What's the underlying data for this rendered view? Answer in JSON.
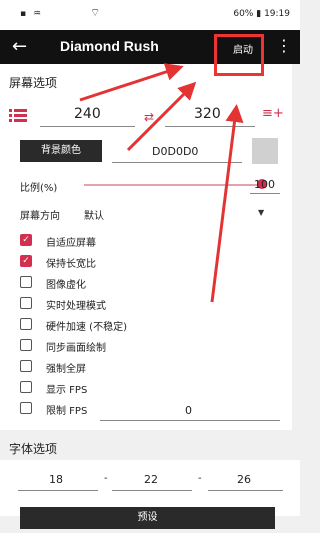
{
  "status": {
    "left": "▪ ♒",
    "wifi": "⌔",
    "battery": "60%",
    "time": "19:19"
  },
  "appbar": {
    "title": "Diamond Rush",
    "start": "启动"
  },
  "screen": {
    "title": "屏幕选项",
    "width": "240",
    "height": "320",
    "bg_button": "背景颜色",
    "bg_value": "D0D0D0",
    "ratio_label": "比例(%)",
    "ratio_value": "100",
    "orientation_label": "屏幕方向",
    "orientation_value": "默认"
  },
  "options": [
    {
      "label": "自适应屏幕",
      "checked": true
    },
    {
      "label": "保持长宽比",
      "checked": true
    },
    {
      "label": "图像虚化",
      "checked": false
    },
    {
      "label": "实时处理模式",
      "checked": false
    },
    {
      "label": "硬件加速 (不稳定)",
      "checked": false
    },
    {
      "label": "同步画面绘制",
      "checked": false
    },
    {
      "label": "强制全屏",
      "checked": false
    },
    {
      "label": "显示 FPS",
      "checked": false
    },
    {
      "label": "限制 FPS",
      "checked": false
    }
  ],
  "fps_value": "0",
  "font": {
    "title": "字体选项",
    "small": "18",
    "medium": "22",
    "large": "26",
    "sep": "-"
  },
  "preset_label": "预设",
  "colors": {
    "accent": "#d32f4f",
    "annotation": "#e33333"
  }
}
